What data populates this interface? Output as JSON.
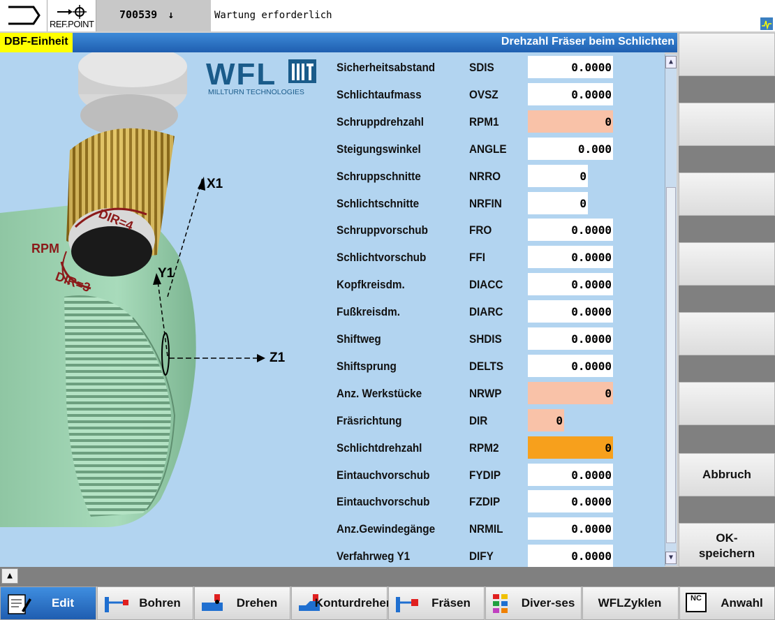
{
  "header": {
    "ref_point": "REF.POINT",
    "alarm_number": "700539",
    "alarm_arrow": "↓",
    "message": "Wartung erforderlich"
  },
  "title_bar": {
    "badge": "DBF-Einheit",
    "title": "Drehzahl Fräser beim Schlichten"
  },
  "logo": {
    "brand": "WFL",
    "subtitle": "MILLTURN TECHNOLOGIES"
  },
  "graphic_labels": {
    "x1": "X1",
    "y1": "Y1",
    "z1": "Z1",
    "rpm": "RPM",
    "dir4": "DIR=4",
    "dir3": "DIR=3"
  },
  "fields": [
    {
      "label": "Sicherheitsabstand",
      "code": "SDIS",
      "value": "0.0000",
      "state": "normal",
      "width": "wide"
    },
    {
      "label": "Schlichtaufmass",
      "code": "OVSZ",
      "value": "0.0000",
      "state": "normal",
      "width": "wide"
    },
    {
      "label": "Schruppdrehzahl",
      "code": "RPM1",
      "value": "0",
      "state": "error",
      "width": "wide"
    },
    {
      "label": "Steigungswinkel",
      "code": "ANGLE",
      "value": "0.000",
      "state": "normal",
      "width": "wide"
    },
    {
      "label": "Schruppschnitte",
      "code": "NRRO",
      "value": "0",
      "state": "normal",
      "width": "narrow"
    },
    {
      "label": "Schlichtschnitte",
      "code": "NRFIN",
      "value": "0",
      "state": "normal",
      "width": "narrow"
    },
    {
      "label": "Schruppvorschub",
      "code": "FRO",
      "value": "0.0000",
      "state": "normal",
      "width": "wide"
    },
    {
      "label": "Schlichtvorschub",
      "code": "FFI",
      "value": "0.0000",
      "state": "normal",
      "width": "wide"
    },
    {
      "label": "Kopfkreisdm.",
      "code": "DIACC",
      "value": "0.0000",
      "state": "normal",
      "width": "wide"
    },
    {
      "label": "Fußkreisdm.",
      "code": "DIARC",
      "value": "0.0000",
      "state": "normal",
      "width": "wide"
    },
    {
      "label": "Shiftweg",
      "code": "SHDIS",
      "value": "0.0000",
      "state": "normal",
      "width": "wide"
    },
    {
      "label": "Shiftsprung",
      "code": "DELTS",
      "value": "0.0000",
      "state": "normal",
      "width": "wide"
    },
    {
      "label": "Anz. Werkstücke",
      "code": "NRWP",
      "value": "0",
      "state": "error",
      "width": "wide"
    },
    {
      "label": "Fräsrichtung",
      "code": "DIR",
      "value": "0",
      "state": "error",
      "width": "small"
    },
    {
      "label": "Schlichtdrehzahl",
      "code": "RPM2",
      "value": "0",
      "state": "active",
      "width": "wide"
    },
    {
      "label": "Eintauchvorschub",
      "code": "FYDIP",
      "value": "0.0000",
      "state": "normal",
      "width": "wide"
    },
    {
      "label": "Eintauchvorschub",
      "code": "FZDIP",
      "value": "0.0000",
      "state": "normal",
      "width": "wide"
    },
    {
      "label": "Anz.Gewindegänge",
      "code": "NRMIL",
      "value": "0.0000",
      "state": "normal",
      "width": "wide"
    },
    {
      "label": "Verfahrweg Y1",
      "code": "DIFY",
      "value": "0.0000",
      "state": "normal",
      "width": "wide"
    }
  ],
  "vertical_softkeys": {
    "abbruch": "Abbruch",
    "ok_line1": "OK-",
    "ok_line2": "speichern"
  },
  "horizontal_softkeys": {
    "edit": "Edit",
    "bohren": "Bohren",
    "drehen": "Drehen",
    "kontur_1": "Kontur",
    "kontur_2": "drehen",
    "fraesen": "Fräsen",
    "diverses_1": "Diver-",
    "diverses_2": "ses",
    "wfl_1": "WFL",
    "wfl_2": "Zyklen",
    "anwahl": "Anwahl",
    "nc_icon_text": "NC"
  },
  "colors": {
    "form_bg": "#b2d4f0",
    "error_field": "#f9c2a8",
    "active_field": "#f7a01c",
    "title_blue": "#2a70c4",
    "badge_yellow": "#ffff00",
    "graphic_labels": "#8b1a1a"
  }
}
